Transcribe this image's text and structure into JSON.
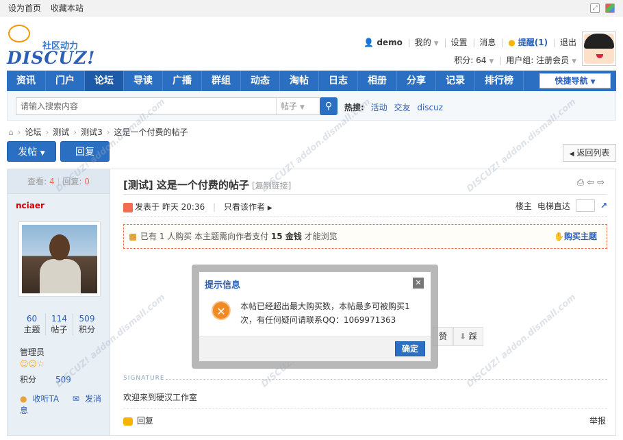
{
  "topbar": {
    "set_home": "设为首页",
    "bookmark": "收藏本站"
  },
  "logo": {
    "tagline": "社区动力",
    "wordmark": "DISCUZ!"
  },
  "user": {
    "name": "demo",
    "my": "我的",
    "settings": "设置",
    "messages": "消息",
    "remind": "提醒(1)",
    "logout": "退出",
    "points": "积分: 64",
    "usergroup": "用户组: 注册会员"
  },
  "nav": {
    "items": [
      "资讯",
      "门户",
      "论坛",
      "导读",
      "广播",
      "群组",
      "动态",
      "淘帖",
      "日志",
      "相册",
      "分享",
      "记录",
      "排行榜"
    ],
    "active": "论坛",
    "quick": "快捷导航"
  },
  "search": {
    "placeholder": "请输入搜索内容",
    "type": "帖子",
    "hot_label": "热搜:",
    "hot": [
      "活动",
      "交友",
      "discuz"
    ]
  },
  "breadcrumb": [
    "论坛",
    "测试",
    "测试3",
    "这是一个付费的帖子"
  ],
  "buttons": {
    "post": "发帖",
    "reply": "回复",
    "back": "返回列表"
  },
  "thread": {
    "views_label": "查看:",
    "views": "4",
    "replies_label": "回复:",
    "replies": "0",
    "title": "[测试] 这是一个付费的帖子",
    "copy_link": "[复制链接]",
    "posted": "发表于 昨天 20:36",
    "only_author": "只看该作者",
    "owner": "楼主",
    "floor_jump": "电梯直达",
    "pay_text_prefix": "已有 1 人购买  本主题需向作者支付",
    "pay_amount": "15 金钱",
    "pay_text_suffix": "才能浏览",
    "buy": "购买主题",
    "vote_partial": "赞",
    "vote_down": "踩",
    "signature_label": "SIGNATURE",
    "signature": "欢迎来到硬汉工作室",
    "reply": "回复",
    "report": "举报"
  },
  "author": {
    "name": "nciaer",
    "stats": [
      {
        "value": "60",
        "label": "主题"
      },
      {
        "value": "114",
        "label": "帖子"
      },
      {
        "value": "509",
        "label": "积分"
      }
    ],
    "group": "管理员",
    "score_label": "积分",
    "score": "509",
    "follow": "收听TA",
    "message": "发消息"
  },
  "dialog": {
    "title": "提示信息",
    "message": "本帖已经超出最大购买数，本帖最多可被购买1次，有任何疑问请联系QQ：1069971363",
    "ok": "确定"
  },
  "watermark": "DISCUZ!应用中心 addon.dismall.com 贰道"
}
